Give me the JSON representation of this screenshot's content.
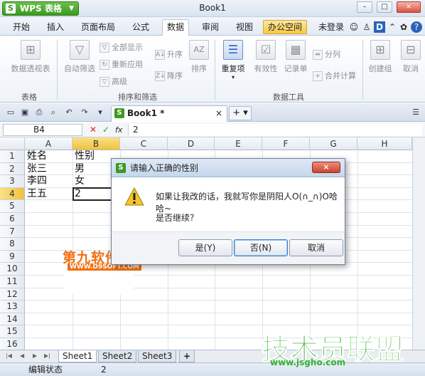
{
  "app": {
    "name": "WPS 表格",
    "logo": "S",
    "title": "Book1"
  },
  "menu": {
    "items": [
      "开始",
      "插入",
      "页面布局",
      "公式",
      "数据",
      "审阅",
      "视图",
      "办公空间"
    ],
    "active": "数据",
    "login": "未登录"
  },
  "ribbon": {
    "pivot": "数据透视表",
    "autofilter": "自动筛选",
    "showall": "全部显示",
    "reapply": "重新应用",
    "advanced": "高级",
    "sort_asc": "升序",
    "sort_desc": "降序",
    "sort": "排序",
    "duplicates": "重复项",
    "validity": "有效性",
    "record": "记录单",
    "split": "分列",
    "consolidate": "合并计算",
    "create_group": "创建组",
    "ungroup": "取消",
    "group_table": "表格",
    "group_sortfilter": "排序和筛选",
    "group_datatools": "数据工具"
  },
  "doc_tab": {
    "name": "Book1 *",
    "close": "×",
    "new": "+"
  },
  "formula": {
    "cell_ref": "B4",
    "value": "2",
    "fx": "fx"
  },
  "grid": {
    "columns": [
      "A",
      "B",
      "C",
      "D",
      "E",
      "F",
      "G",
      "H"
    ],
    "rows": [
      "1",
      "2",
      "3",
      "4",
      "5",
      "6",
      "7",
      "8",
      "9",
      "10",
      "11",
      "12",
      "13",
      "14",
      "15",
      "16"
    ],
    "cells": [
      {
        "ref": "A1",
        "text": "姓名"
      },
      {
        "ref": "B1",
        "text": "性别"
      },
      {
        "ref": "A2",
        "text": "张三"
      },
      {
        "ref": "B2",
        "text": "男"
      },
      {
        "ref": "A3",
        "text": "李四"
      },
      {
        "ref": "B3",
        "text": "女"
      },
      {
        "ref": "A4",
        "text": "王五"
      },
      {
        "ref": "B4",
        "text": "2"
      }
    ]
  },
  "sheets": {
    "tabs": [
      "Sheet1",
      "Sheet2",
      "Sheet3"
    ],
    "active": "Sheet1",
    "add": "+"
  },
  "status": {
    "mode": "编辑状态",
    "value": "2"
  },
  "dialog": {
    "title": "请输入正确的性别",
    "message": "如果让我改的话，我就写你是阴阳人O(∩_∩)O哈哈~",
    "question": "是否继续？",
    "yes": "是(Y)",
    "no": "否(N)",
    "cancel": "取消",
    "close": "×"
  },
  "watermarks": {
    "top_brand": "第九软件网",
    "top_url": "WWW.D9SOFT.COM",
    "bottom_brand": "技术员联盟",
    "bottom_url": "www.jsgho.com"
  }
}
